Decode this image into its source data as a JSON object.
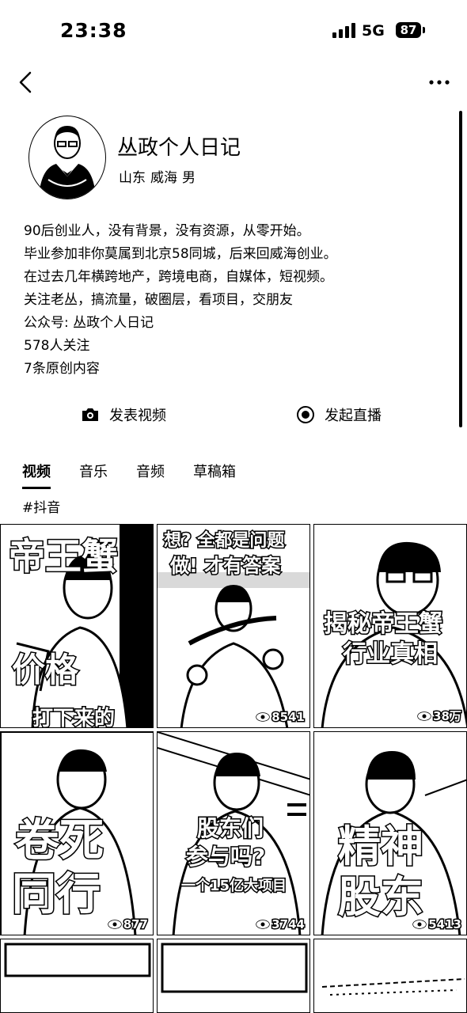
{
  "status_bar": {
    "time": "23:38",
    "network": "5G",
    "battery": "87"
  },
  "profile": {
    "name": "丛政个人日记",
    "location_province": "山东",
    "location_city": "威海",
    "gender": "男",
    "bio": [
      "90后创业人，没有背景，没有资源，从零开始。",
      "毕业参加非你莫属到北京58同城，后来回威海创业。",
      "在过去几年横跨地产，跨境电商，自媒体，短视频。",
      "关注老丛，搞流量，破圈层，看项目，交朋友",
      "公众号: 丛政个人日记"
    ],
    "followers": "578人关注",
    "original_count": "7条原创内容"
  },
  "actions": {
    "post_video": "发表视频",
    "go_live": "发起直播"
  },
  "tabs": [
    {
      "label": "视频",
      "active": true
    },
    {
      "label": "音乐",
      "active": false
    },
    {
      "label": "音频",
      "active": false
    },
    {
      "label": "草稿箱",
      "active": false
    }
  ],
  "hashtag": "#抖音",
  "videos": [
    {
      "lines": [
        "帝王蟹",
        "价格",
        "打下来的"
      ],
      "views": ""
    },
    {
      "lines": [
        "想? 全都是问题",
        "做! 才有答案"
      ],
      "views": "8541"
    },
    {
      "lines": [
        "揭秘帝王蟹",
        "行业真相"
      ],
      "views": "38万"
    },
    {
      "lines": [
        "卷死",
        "同行"
      ],
      "views": "877"
    },
    {
      "lines": [
        "股东们",
        "参与吗?",
        "一个15亿大项目"
      ],
      "views": "3744"
    },
    {
      "lines": [
        "精神",
        "股东"
      ],
      "views": "5413"
    }
  ],
  "icons": {
    "back": "chevron-left-icon",
    "more": "more-icon",
    "camera": "camera-icon",
    "live": "live-record-icon",
    "eye": "eye-icon"
  }
}
